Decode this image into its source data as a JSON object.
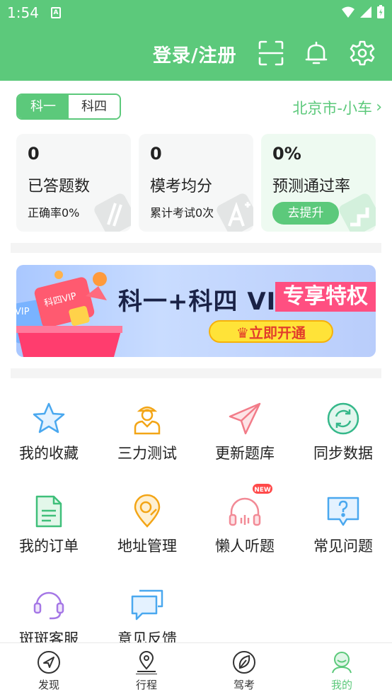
{
  "status_bar": {
    "time": "1:54",
    "notification_glyph": "A"
  },
  "header": {
    "title": "登录/注册",
    "icons": [
      "scan-icon",
      "bell-icon",
      "gear-icon"
    ]
  },
  "subject_tabs": [
    {
      "label": "科一",
      "active": true
    },
    {
      "label": "科四",
      "active": false
    }
  ],
  "city": {
    "label": "北京市-小车",
    "chevron": "›"
  },
  "stats": [
    {
      "value": "0",
      "label": "已答题数",
      "sub": "正确率0%"
    },
    {
      "value": "0",
      "label": "模考均分",
      "sub": "累计考试0次"
    },
    {
      "value": "0%",
      "label": "预测通过率",
      "button": "去提升"
    }
  ],
  "banner": {
    "headline": "科一+科四 VIP",
    "tag": "专享特权",
    "cta": "立即开通",
    "gift_text": "科四VIP",
    "gift_text2": "VIP"
  },
  "grid": [
    {
      "label": "我的收藏",
      "icon": "star-icon"
    },
    {
      "label": "三力测试",
      "icon": "person-icon"
    },
    {
      "label": "更新题库",
      "icon": "paper-plane-icon"
    },
    {
      "label": "同步数据",
      "icon": "sync-icon"
    },
    {
      "label": "我的订单",
      "icon": "document-icon"
    },
    {
      "label": "地址管理",
      "icon": "location-pin-icon"
    },
    {
      "label": "懒人听题",
      "icon": "headphones-icon",
      "badge": "NEW"
    },
    {
      "label": "常见问题",
      "icon": "question-icon"
    },
    {
      "label": "斑斑客服",
      "icon": "headset-icon"
    },
    {
      "label": "意见反馈",
      "icon": "chat-bubbles-icon"
    }
  ],
  "bottom_nav": [
    {
      "label": "发现",
      "icon": "compass-icon",
      "active": false
    },
    {
      "label": "行程",
      "icon": "route-icon",
      "active": false
    },
    {
      "label": "驾考",
      "icon": "leaf-icon",
      "active": false
    },
    {
      "label": "我的",
      "icon": "profile-icon",
      "active": true
    }
  ],
  "colors": {
    "primary": "#5cc97b",
    "vip_pink": "#ff4f81",
    "cta_yellow": "#ffe338"
  }
}
